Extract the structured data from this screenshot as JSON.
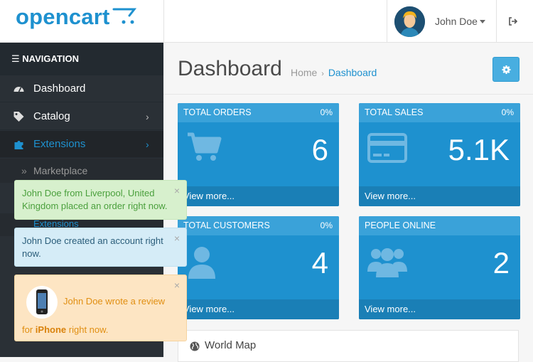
{
  "header": {
    "logo_text": "opencart",
    "user_name": "John Doe",
    "icons": {
      "cart": "cart-logo-icon",
      "user_menu": "caret-down-icon",
      "logout": "logout-icon"
    }
  },
  "sidebar": {
    "heading": "NAVIGATION",
    "items": [
      {
        "label": "Dashboard",
        "icon": "dashboard-icon"
      },
      {
        "label": "Catalog",
        "icon": "tag-icon",
        "chevron": "›"
      },
      {
        "label": "Extensions",
        "icon": "puzzle-icon",
        "chevron": "›",
        "active": true
      }
    ],
    "subitems": [
      {
        "label": "Marketplace"
      },
      {
        "label": "Extensions"
      }
    ],
    "sub_marker": "»"
  },
  "page": {
    "title": "Dashboard",
    "breadcrumb": [
      "Home",
      "Dashboard"
    ],
    "breadcrumb_sep": "›"
  },
  "tiles": [
    {
      "title": "TOTAL ORDERS",
      "percent": "0%",
      "value": "6",
      "footer": "View more...",
      "icon": "shopping-cart-icon"
    },
    {
      "title": "TOTAL SALES",
      "percent": "0%",
      "value": "5.1K",
      "footer": "View more...",
      "icon": "credit-card-icon"
    },
    {
      "title": "TOTAL CUSTOMERS",
      "percent": "0%",
      "value": "4",
      "footer": "View more...",
      "icon": "user-icon"
    },
    {
      "title": "PEOPLE ONLINE",
      "percent": "",
      "value": "2",
      "footer": "View more...",
      "icon": "users-icon"
    }
  ],
  "world_map": {
    "label": "World Map"
  },
  "alerts": [
    {
      "text": "John Doe from Liverpool, United Kingdom placed an order right now.",
      "close": "×"
    },
    {
      "text": "John Doe created an account right now.",
      "close": "×"
    },
    {
      "text_before": "John Doe wrote a review",
      "for_word": "for",
      "product": "iPhone",
      "text_after": "right now.",
      "close": "×"
    }
  ],
  "colors": {
    "accent": "#1e91cf",
    "sidebar_bg": "#2a3036",
    "success_bg": "#d7f0cd",
    "info_bg": "#d5ecf7",
    "warning_bg": "#fde5c3"
  }
}
